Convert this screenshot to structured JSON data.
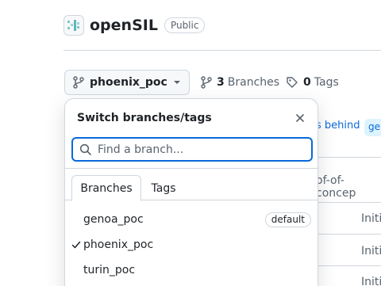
{
  "repo": {
    "name": "openSIL",
    "visibility": "Public"
  },
  "branch_selector": {
    "current": "phoenix_poc"
  },
  "stats": {
    "branches_count": "3",
    "branches_label": "Branches",
    "tags_count": "0",
    "tags_label": "Tags"
  },
  "background": {
    "behind_text": "s behind",
    "branch_pill": "ger",
    "commit_message": "of-of-concep",
    "row_texts": [
      "Initi",
      "Initi",
      "Initi"
    ]
  },
  "popover": {
    "title": "Switch branches/tags",
    "search_placeholder": "Find a branch...",
    "tabs": [
      "Branches",
      "Tags"
    ],
    "active_tab": "Branches",
    "branches": [
      {
        "name": "genoa_poc",
        "badge": "default",
        "selected": false
      },
      {
        "name": "phoenix_poc",
        "badge": "",
        "selected": true
      },
      {
        "name": "turin_poc",
        "badge": "",
        "selected": false
      }
    ]
  },
  "colors": {
    "accent": "#0969da",
    "border": "#d0d7de",
    "muted": "#59636e",
    "text": "#1f2328"
  }
}
